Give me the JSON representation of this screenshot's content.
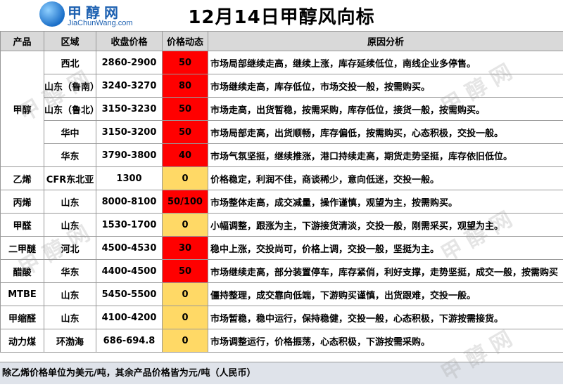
{
  "logo": {
    "cn": "甲醇网",
    "en": "JiaChunWang.com"
  },
  "title": "12月14日甲醇风向标",
  "headers": [
    "产品",
    "区域",
    "收盘价格",
    "价格动态",
    "原因分析"
  ],
  "rows": [
    {
      "product": "甲醇",
      "region": "西北",
      "price": "2860-2900",
      "change": "50",
      "level": "red",
      "reason": "市场局部继续走高，继续上涨，库存延续低位，南线企业多停售。"
    },
    {
      "product": "",
      "region": "山东（鲁南）",
      "price": "3240-3270",
      "change": "80",
      "level": "red",
      "reason": "市场继续走高，库存低位，市场交投一般，按需购买。"
    },
    {
      "product": "",
      "region": "山东（鲁北）",
      "price": "3150-3230",
      "change": "50",
      "level": "red",
      "reason": "市场走高，出货暂稳，按需采购，库存低位，接货一般，按需购买。"
    },
    {
      "product": "",
      "region": "华中",
      "price": "3150-3200",
      "change": "50",
      "level": "red",
      "reason": "市场局部走高，出货顺畅，库存偏低，按需购买，心态积极，交投一般。"
    },
    {
      "product": "",
      "region": "华东",
      "price": "3790-3800",
      "change": "40",
      "level": "red",
      "reason": "市场气氛坚挺，继续推涨，港口持续走高，期货走势坚挺，库存依旧低位。"
    },
    {
      "product": "乙烯",
      "region": "CFR东北亚",
      "price": "1300",
      "change": "0",
      "level": "yellow",
      "reason": "价格稳定，利润不佳，商谈稀少，意向低迷，交投一般。"
    },
    {
      "product": "丙烯",
      "region": "山东",
      "price": "8000-8100",
      "change": "50/100",
      "level": "red",
      "reason": "市场整体走高，成交减量，操作谨慎，观望为主，按需购买。"
    },
    {
      "product": "甲醛",
      "region": "山东",
      "price": "1530-1700",
      "change": "0",
      "level": "yellow",
      "reason": "小幅调整，跟涨为主，下游接货清淡，交投一般，刚需采买，观望为主。"
    },
    {
      "product": "二甲醚",
      "region": "河北",
      "price": "4500-4530",
      "change": "30",
      "level": "red",
      "reason": "稳中上涨，交投尚可，价格上调，交投一般，坚挺为主。"
    },
    {
      "product": "醋酸",
      "region": "华东",
      "price": "4400-4500",
      "change": "50",
      "level": "red",
      "reason": "市场继续走高，部分装置停车，库存紧俏，利好支撑，走势坚挺，成交一般，按需购买"
    },
    {
      "product": "MTBE",
      "region": "山东",
      "price": "5450-5500",
      "change": "0",
      "level": "yellow",
      "reason": "僵持整理，成交靠向低端，下游购买谨慎，出货跟难，交投一般。"
    },
    {
      "product": "甲缩醛",
      "region": "山东",
      "price": "4100-4200",
      "change": "0",
      "level": "yellow",
      "reason": "市场暂稳，稳中运行，保持稳健，交投一般，心态积极，下游按需接货。"
    },
    {
      "product": "动力煤",
      "region": "环渤海",
      "price": "686-694.8",
      "change": "0",
      "level": "yellow",
      "reason": "市场调整运行，价格振荡，心态积极，下游按需采购。"
    }
  ],
  "footer": "除乙烯价格单位为美元/吨，其余产品价格皆为元/吨（人民币）",
  "colors": {
    "red": "#ff0000",
    "yellow": "#ffd966",
    "header_bg": "#d9d9d9",
    "footer_bg": "#dfe3ea",
    "logo_blue": "#1b5fb0"
  }
}
